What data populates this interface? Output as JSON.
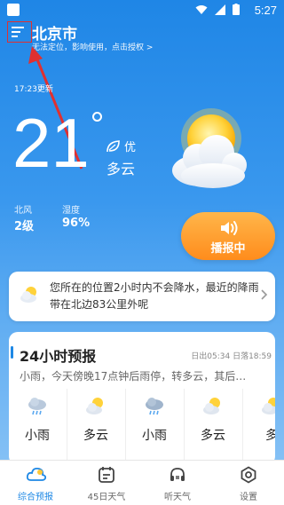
{
  "status_bar": {
    "time": "5:27"
  },
  "header": {
    "city": "北京市",
    "location_note": "无法定位，影响使用，点击授权 >"
  },
  "current": {
    "updated": "17:23更新",
    "temperature": "21",
    "air_quality": "优",
    "condition": "多云",
    "wind_label": "北风",
    "wind_value": "2级",
    "humidity_label": "湿度",
    "humidity_value": "96%",
    "broadcast_label": "播报中"
  },
  "rain_alert": {
    "text": "您所在的位置2小时内不会降水，最近的降雨带在北边83公里外呢"
  },
  "forecast": {
    "title": "24小时预报",
    "sunrise": "日出05:34",
    "sunset": "日落18:59",
    "summary": "小雨，今天傍晚17点钟后雨停，转多云，其后…",
    "items": [
      {
        "label": "小雨",
        "icon": "rain-cloud-icon"
      },
      {
        "label": "多云",
        "icon": "partly-cloudy-icon"
      },
      {
        "label": "小雨",
        "icon": "rain-cloud-icon"
      },
      {
        "label": "多云",
        "icon": "partly-cloudy-icon"
      },
      {
        "label": "多",
        "icon": "partly-cloudy-icon"
      }
    ]
  },
  "nav": {
    "items": [
      {
        "label": "综合预报",
        "icon": "cloud-icon",
        "active": true
      },
      {
        "label": "45日天气",
        "icon": "calendar-icon",
        "active": false
      },
      {
        "label": "听天气",
        "icon": "headphones-icon",
        "active": false
      },
      {
        "label": "设置",
        "icon": "settings-icon",
        "active": false
      }
    ]
  },
  "colors": {
    "accent": "#1e88e5",
    "broadcast": "#ff9a2a",
    "annotation": "#e03030"
  }
}
